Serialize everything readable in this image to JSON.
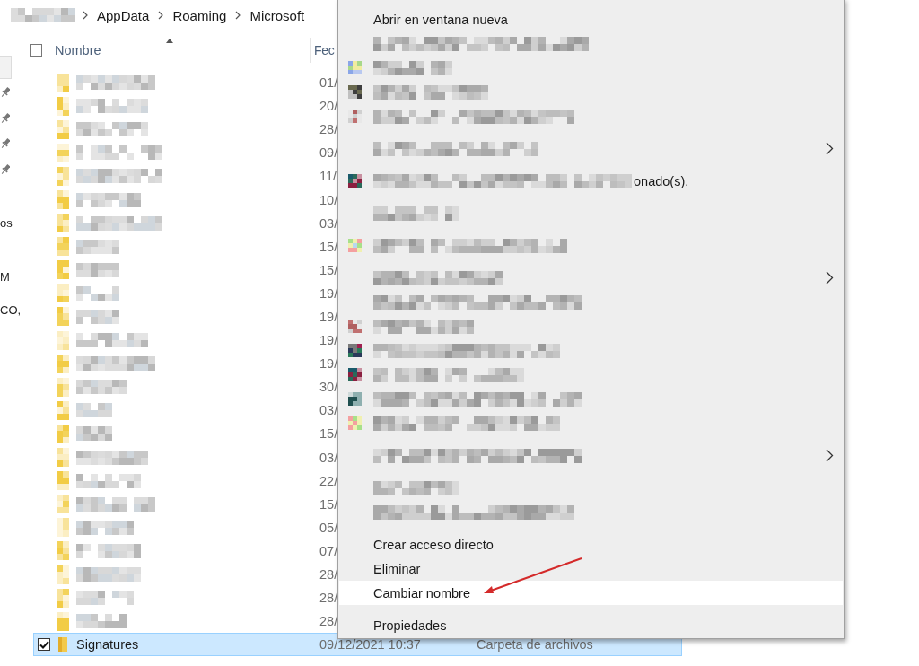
{
  "address_bar": {
    "crumbs": [
      "AppData",
      "Roaming",
      "Microsoft"
    ]
  },
  "nav_pane": {
    "items": [
      {
        "kind": "highlight",
        "selected": true
      },
      {
        "kind": "pin"
      },
      {
        "kind": "pin"
      },
      {
        "kind": "pin"
      },
      {
        "kind": "pin"
      },
      {
        "kind": "text",
        "label": "os",
        "selected": false
      },
      {
        "kind": "text",
        "label": "M",
        "selected": false
      },
      {
        "kind": "text",
        "label": "CO,",
        "selected": false
      }
    ]
  },
  "file_list": {
    "select_all_checked": false,
    "columns": [
      {
        "label": "Nombre",
        "sorted": true
      },
      {
        "label": "Fec",
        "sorted": false
      }
    ],
    "rows": [
      {
        "date": "01/",
        "selected": false,
        "checked": false
      },
      {
        "date": "20/",
        "selected": false,
        "checked": false
      },
      {
        "date": "28/",
        "selected": false,
        "checked": false
      },
      {
        "date": "09/",
        "selected": false,
        "checked": false
      },
      {
        "date": "11/",
        "selected": false,
        "checked": false
      },
      {
        "date": "10/",
        "selected": false,
        "checked": false
      },
      {
        "date": "03/",
        "selected": false,
        "checked": false
      },
      {
        "date": "15/",
        "selected": false,
        "checked": false
      },
      {
        "date": "15/",
        "selected": false,
        "checked": false
      },
      {
        "date": "19/",
        "selected": false,
        "checked": false
      },
      {
        "date": "19/",
        "selected": false,
        "checked": false
      },
      {
        "date": "19/",
        "selected": false,
        "checked": false
      },
      {
        "date": "19/",
        "selected": false,
        "checked": false
      },
      {
        "date": "30/",
        "selected": false,
        "checked": false
      },
      {
        "date": "03/",
        "selected": false,
        "checked": false
      },
      {
        "date": "15/",
        "selected": false,
        "checked": false
      },
      {
        "date": "03/",
        "selected": false,
        "checked": false
      },
      {
        "date": "22/",
        "selected": false,
        "checked": false
      },
      {
        "date": "15/",
        "selected": false,
        "checked": false
      },
      {
        "date": "05/",
        "selected": false,
        "checked": false
      },
      {
        "date": "07/",
        "selected": false,
        "checked": false
      },
      {
        "date": "28/",
        "selected": false,
        "checked": false
      },
      {
        "date": "28/",
        "selected": false,
        "checked": false
      },
      {
        "date": "28/",
        "selected": false,
        "checked": false
      },
      {
        "name": "Signatures",
        "date": "09/12/2021 10:37",
        "type": "Carpeta de archivos",
        "selected": true,
        "checked": true
      }
    ]
  },
  "context_menu": {
    "groups": [
      {
        "items": [
          {
            "kind": "text",
            "label": "Abrir en ventana nueva",
            "highlighted": false
          },
          {
            "kind": "redacted",
            "highlighted": false
          },
          {
            "kind": "redacted",
            "icon": true,
            "highlighted": false
          },
          {
            "kind": "redacted",
            "icon": true,
            "highlighted": false
          },
          {
            "kind": "redacted",
            "icon": true,
            "highlighted": false
          }
        ]
      },
      {
        "items": [
          {
            "kind": "redacted",
            "submenu": true,
            "highlighted": false
          }
        ]
      },
      {
        "items": [
          {
            "kind": "redacted",
            "icon": true,
            "suffix": "onado(s).",
            "highlighted": false
          }
        ]
      },
      {
        "items": [
          {
            "kind": "redacted",
            "highlighted": false
          }
        ]
      },
      {
        "items": [
          {
            "kind": "redacted",
            "icon": true,
            "highlighted": false
          }
        ]
      },
      {
        "items": [
          {
            "kind": "redacted",
            "submenu": true,
            "highlighted": false
          },
          {
            "kind": "redacted",
            "highlighted": false
          },
          {
            "kind": "redacted",
            "icon": true,
            "highlighted": false
          },
          {
            "kind": "redacted",
            "icon": true,
            "highlighted": false
          },
          {
            "kind": "redacted",
            "icon": true,
            "highlighted": false
          },
          {
            "kind": "redacted",
            "icon": true,
            "highlighted": false
          },
          {
            "kind": "redacted",
            "icon": true,
            "highlighted": false
          }
        ]
      },
      {
        "items": [
          {
            "kind": "redacted",
            "submenu": true,
            "highlighted": false
          }
        ]
      },
      {
        "items": [
          {
            "kind": "redacted",
            "highlighted": false
          },
          {
            "kind": "redacted",
            "highlighted": false
          }
        ]
      },
      {
        "items": [
          {
            "kind": "text",
            "label": "Crear acceso directo",
            "highlighted": false
          },
          {
            "kind": "text",
            "label": "Eliminar",
            "highlighted": false
          },
          {
            "kind": "text",
            "label": "Cambiar nombre",
            "highlighted": true
          }
        ]
      },
      {
        "items": [
          {
            "kind": "text",
            "label": "Propiedades",
            "highlighted": false
          }
        ]
      }
    ]
  }
}
